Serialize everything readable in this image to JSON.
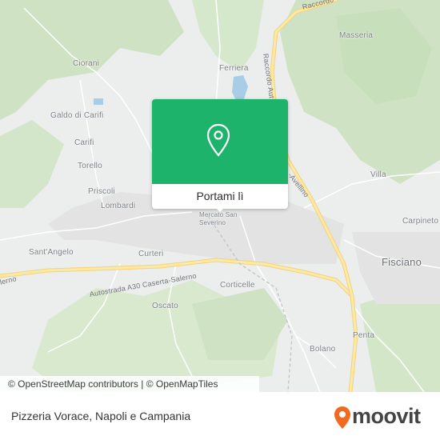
{
  "map": {
    "places": [
      {
        "id": "ciorani",
        "label": "Ciorani"
      },
      {
        "id": "galdo",
        "label": "Galdo di Carifi"
      },
      {
        "id": "carifi",
        "label": "Carifi"
      },
      {
        "id": "torello",
        "label": "Torello"
      },
      {
        "id": "priscoli",
        "label": "Priscoli"
      },
      {
        "id": "lombardi",
        "label": "Lombardi"
      },
      {
        "id": "santangelo",
        "label": "Sant'Angelo"
      },
      {
        "id": "curteri",
        "label": "Curteri"
      },
      {
        "id": "corticelle",
        "label": "Corticelle"
      },
      {
        "id": "oscato",
        "label": "Oscato"
      },
      {
        "id": "ferriera",
        "label": "Ferriera"
      },
      {
        "id": "masseria",
        "label": "Masseria"
      },
      {
        "id": "villa",
        "label": "Villa"
      },
      {
        "id": "carpineto",
        "label": "Carpineto"
      },
      {
        "id": "fisciano",
        "label": "Fisciano"
      },
      {
        "id": "penta",
        "label": "Penta"
      },
      {
        "id": "bolano",
        "label": "Bolano"
      },
      {
        "id": "mercato",
        "label": "Mercato San Severino"
      }
    ],
    "roads": {
      "a30": "Autostrada A30 Caserta-Salerno",
      "a30_left": "lerno",
      "raccordo": "Raccordo Aut",
      "raccordo_top": "Raccordo",
      "avellino": "-Avellino"
    }
  },
  "popup": {
    "button_label": "Portami lì",
    "pin_icon": "location-pin-icon",
    "color": "#1eb36b"
  },
  "attribution": {
    "osm": "© OpenStreetMap contributors",
    "sep": " | ",
    "omt": "© OpenMapTiles"
  },
  "footer": {
    "title": "Pizzeria Vorace, Napoli e Campania",
    "logo": "moovit",
    "logo_color": "#f26a21"
  }
}
